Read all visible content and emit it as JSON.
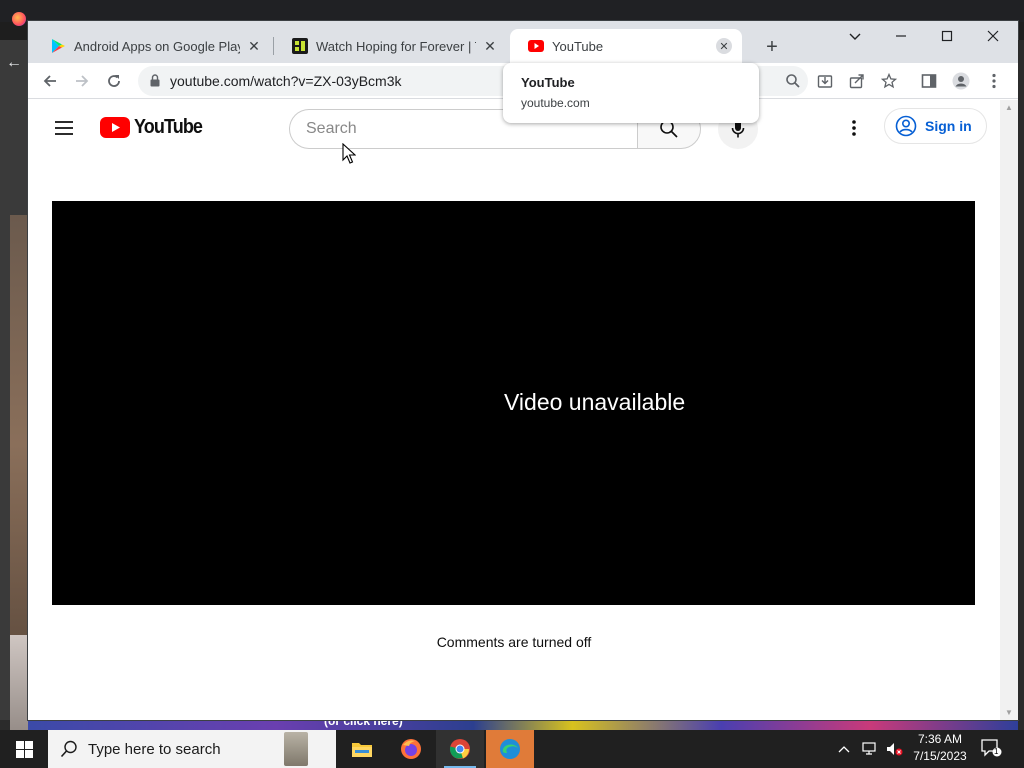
{
  "background": {
    "bottom_banner_text": "(or click here)"
  },
  "tabs": [
    {
      "title": "Android Apps on Google Play",
      "favicon": "google-play-icon"
    },
    {
      "title": "Watch Hoping for Forever | The",
      "favicon": "tubi-icon"
    },
    {
      "title": "YouTube",
      "favicon": "youtube-icon",
      "active": true
    }
  ],
  "toolbar": {
    "url": "youtube.com/watch?v=ZX-03yBcm3k"
  },
  "hovercard": {
    "title": "YouTube",
    "domain": "youtube.com"
  },
  "youtube": {
    "logo_text": "YouTube",
    "search_placeholder": "Search",
    "sign_in_label": "Sign in",
    "player_message": "Video unavailable",
    "comments_status": "Comments are turned off"
  },
  "taskbar": {
    "search_placeholder": "Type here to search",
    "time": "7:36 AM",
    "date": "7/15/2023",
    "notification_count": "1",
    "apps": [
      "file-explorer-icon",
      "firefox-icon",
      "chrome-icon",
      "edge-icon"
    ]
  },
  "colors": {
    "youtube_red": "#ff0000",
    "link_blue": "#065fd4",
    "tabstrip_bg": "#dee1e6",
    "taskbar_bg": "#202020"
  }
}
